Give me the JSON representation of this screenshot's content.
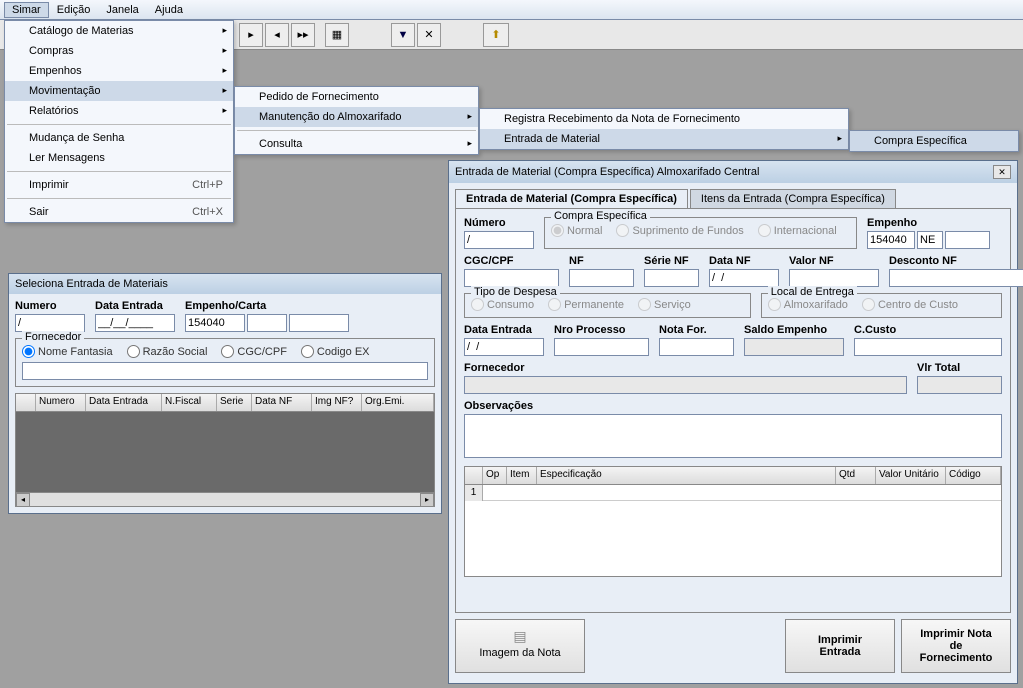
{
  "menubar": {
    "simar": "Simar",
    "edicao": "Edição",
    "janela": "Janela",
    "ajuda": "Ajuda"
  },
  "menu1": {
    "catalogo": "Catálogo de Materias",
    "compras": "Compras",
    "empenhos": "Empenhos",
    "movimentacao": "Movimentação",
    "relatorios": "Relatórios",
    "mudanca": "Mudança de Senha",
    "mensagens": "Ler Mensagens",
    "imprimir": "Imprimir",
    "imprimir_sc": "Ctrl+P",
    "sair": "Sair",
    "sair_sc": "Ctrl+X"
  },
  "menu2": {
    "pedido": "Pedido de Fornecimento",
    "manutencao": "Manutenção do Almoxarifado",
    "consulta": "Consulta"
  },
  "menu3": {
    "registra": "Registra Recebimento da Nota de Fornecimento",
    "entrada": "Entrada de Material"
  },
  "menu4": {
    "compra": "Compra Específica"
  },
  "win1": {
    "title": "Seleciona Entrada de Materiais",
    "numero": "Numero",
    "numero_val": "/",
    "data": "Data Entrada",
    "data_val": "__/__/____",
    "emp": "Empenho/Carta",
    "emp_val": "154040",
    "fornecedor": "Fornecedor",
    "r_nome": "Nome Fantasia",
    "r_razao": "Razão Social",
    "r_cgc": "CGC/CPF",
    "r_codigo": "Codigo EX",
    "th": [
      "",
      "Numero",
      "Data Entrada",
      "N.Fiscal",
      "Serie",
      "Data NF",
      "Img NF?",
      "Org.Emi."
    ]
  },
  "win2": {
    "title": "Entrada de Material (Compra Específica) Almoxarifado Central",
    "tab1": "Entrada de Material (Compra Específica)",
    "tab2": "Itens da Entrada (Compra Específica)",
    "numero": "Número",
    "numero_val": "/",
    "compra": "Compra Específica",
    "r_normal": "Normal",
    "r_sup": "Suprimento de Fundos",
    "r_int": "Internacional",
    "empenho": "Empenho",
    "empenho_val": "154040",
    "empenho_val2": "NE",
    "cgc": "CGC/CPF",
    "nf": "NF",
    "serienf": "Série NF",
    "datanf": "Data NF",
    "datanf_val": "/  /",
    "valornf": "Valor NF",
    "desconto": "Desconto NF",
    "tipodesp": "Tipo de Despesa",
    "r_consumo": "Consumo",
    "r_perm": "Permanente",
    "r_serv": "Serviço",
    "localent": "Local de Entrega",
    "r_almox": "Almoxarifado",
    "r_centro": "Centro de Custo",
    "dataent": "Data Entrada",
    "dataent_val": "/  /",
    "nroproc": "Nro Processo",
    "notafor": "Nota For.",
    "saldoemp": "Saldo Empenho",
    "ccusto": "C.Custo",
    "fornec": "Fornecedor",
    "vlrtotal": "Vlr Total",
    "obs": "Observações",
    "th": [
      "",
      "Op",
      "Item",
      "Especificação",
      "Qtd",
      "Valor Unitário",
      "Código"
    ],
    "row1": "1",
    "btn_img": "Imagem da Nota",
    "btn_imp": "Imprimir Entrada",
    "btn_impnota": "Imprimir Nota de Fornecimento"
  }
}
